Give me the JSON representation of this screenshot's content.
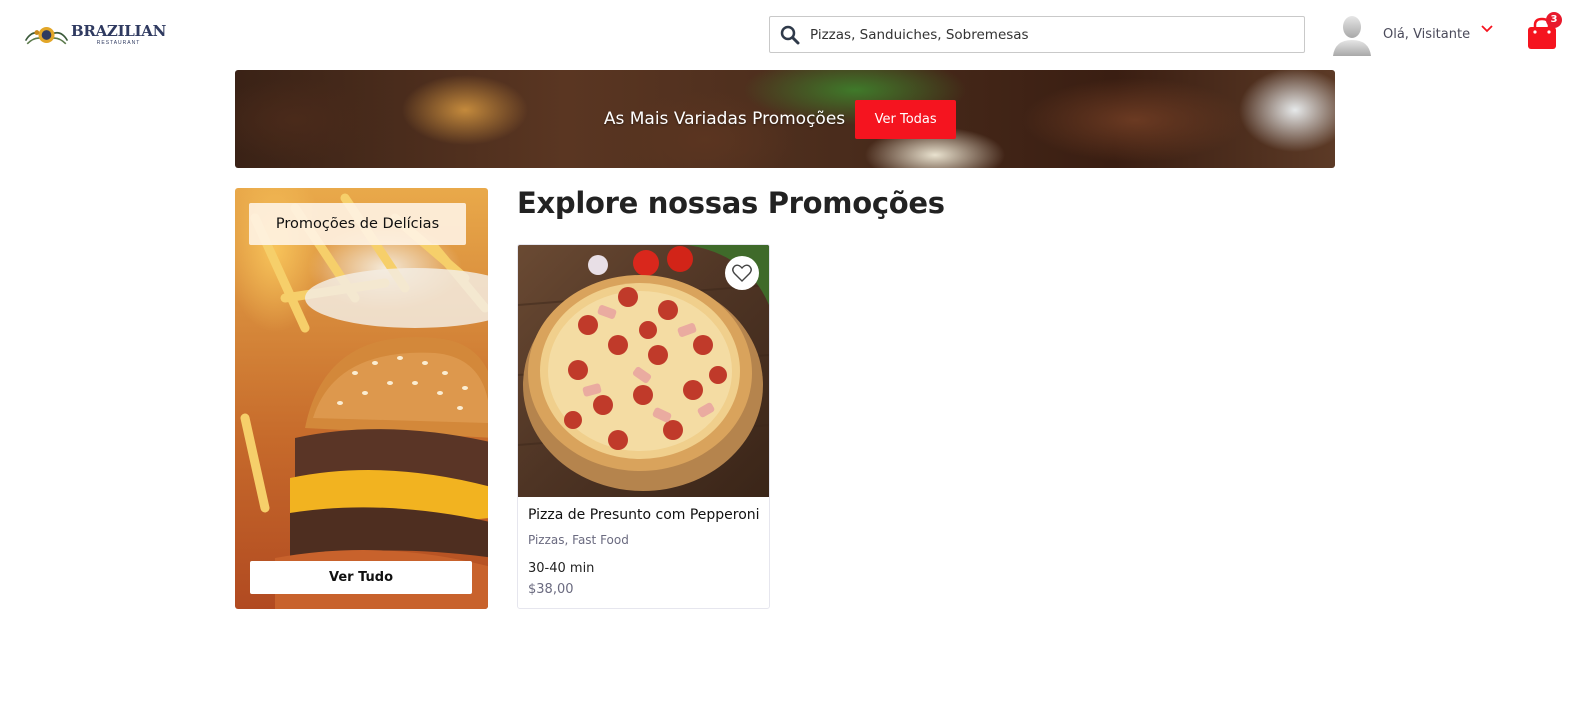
{
  "header": {
    "logo": {
      "name": "BRAZILIAN",
      "sub": "RESTAURANT"
    },
    "search": {
      "placeholder": "Pizzas, Sanduiches, Sobremesas",
      "icon": "search-icon"
    },
    "user": {
      "greeting": "Olá, Visitante",
      "icon": "avatar"
    },
    "cart": {
      "count": "3",
      "icon": "shopping-bag-icon",
      "color": "#f5141f"
    }
  },
  "banner": {
    "title": "As Mais Variadas Promoções",
    "button_label": "Ver Todas"
  },
  "promo_card": {
    "label": "Promoções de Delícias",
    "button_label": "Ver Tudo"
  },
  "section": {
    "title": "Explore nossas Promoções"
  },
  "products": [
    {
      "name": "Pizza de Presunto com Pepperoni",
      "categories": "Pizzas, Fast Food",
      "time": "30-40 min",
      "price": "$38,00"
    }
  ],
  "colors": {
    "accent": "#f5141f",
    "text_muted": "#6b6b80"
  }
}
